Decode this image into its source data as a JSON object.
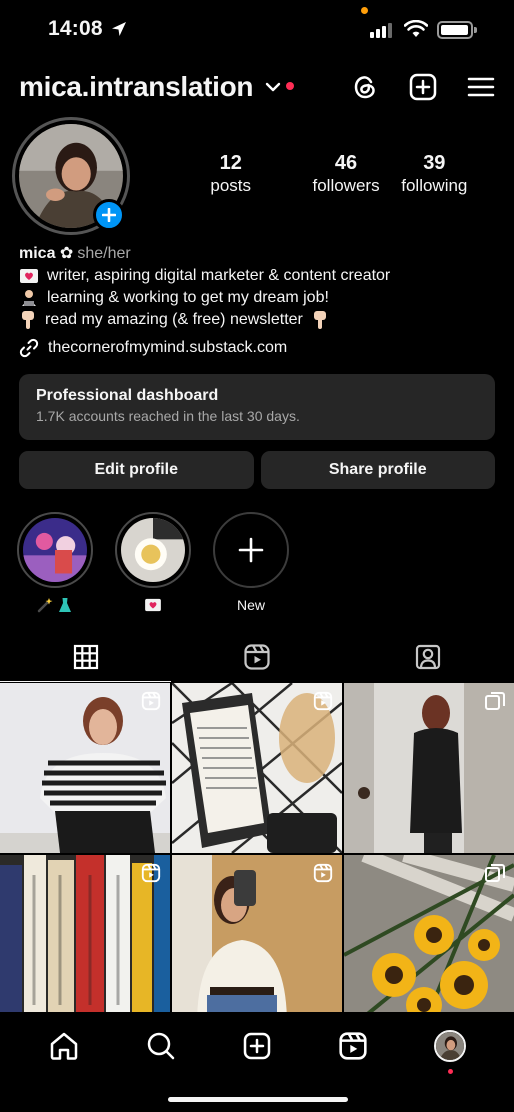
{
  "status_bar": {
    "time": "14:08"
  },
  "header": {
    "username": "mica.intranslation"
  },
  "profile": {
    "stats": [
      {
        "value": "12",
        "label": "posts"
      },
      {
        "value": "46",
        "label": "followers"
      },
      {
        "value": "39",
        "label": "following"
      }
    ],
    "name": "mica ✿",
    "pronouns": "she/her",
    "bio_lines": [
      "writer, aspiring digital marketer & content creator",
      "learning & working to get my dream job!",
      "read my amazing (& free) newsletter"
    ],
    "link": "thecornerofmymind.substack.com"
  },
  "dashboard": {
    "title": "Professional dashboard",
    "subtitle": "1.7K accounts reached in the last 30 days."
  },
  "buttons": {
    "edit": "Edit profile",
    "share": "Share profile"
  },
  "highlights": {
    "new_label": "New"
  },
  "colors": {
    "accent_blue": "#0095f6",
    "notification_red": "#ff2d55",
    "surface": "#262626",
    "background": "#000000"
  },
  "icons": {
    "header": [
      "chevron-down-icon",
      "threads-icon",
      "new-post-icon",
      "menu-icon"
    ],
    "tabs": [
      "grid-icon",
      "reels-icon",
      "tagged-icon"
    ],
    "nav": [
      "home-icon",
      "search-icon",
      "create-icon",
      "reels-icon",
      "profile-avatar"
    ]
  }
}
